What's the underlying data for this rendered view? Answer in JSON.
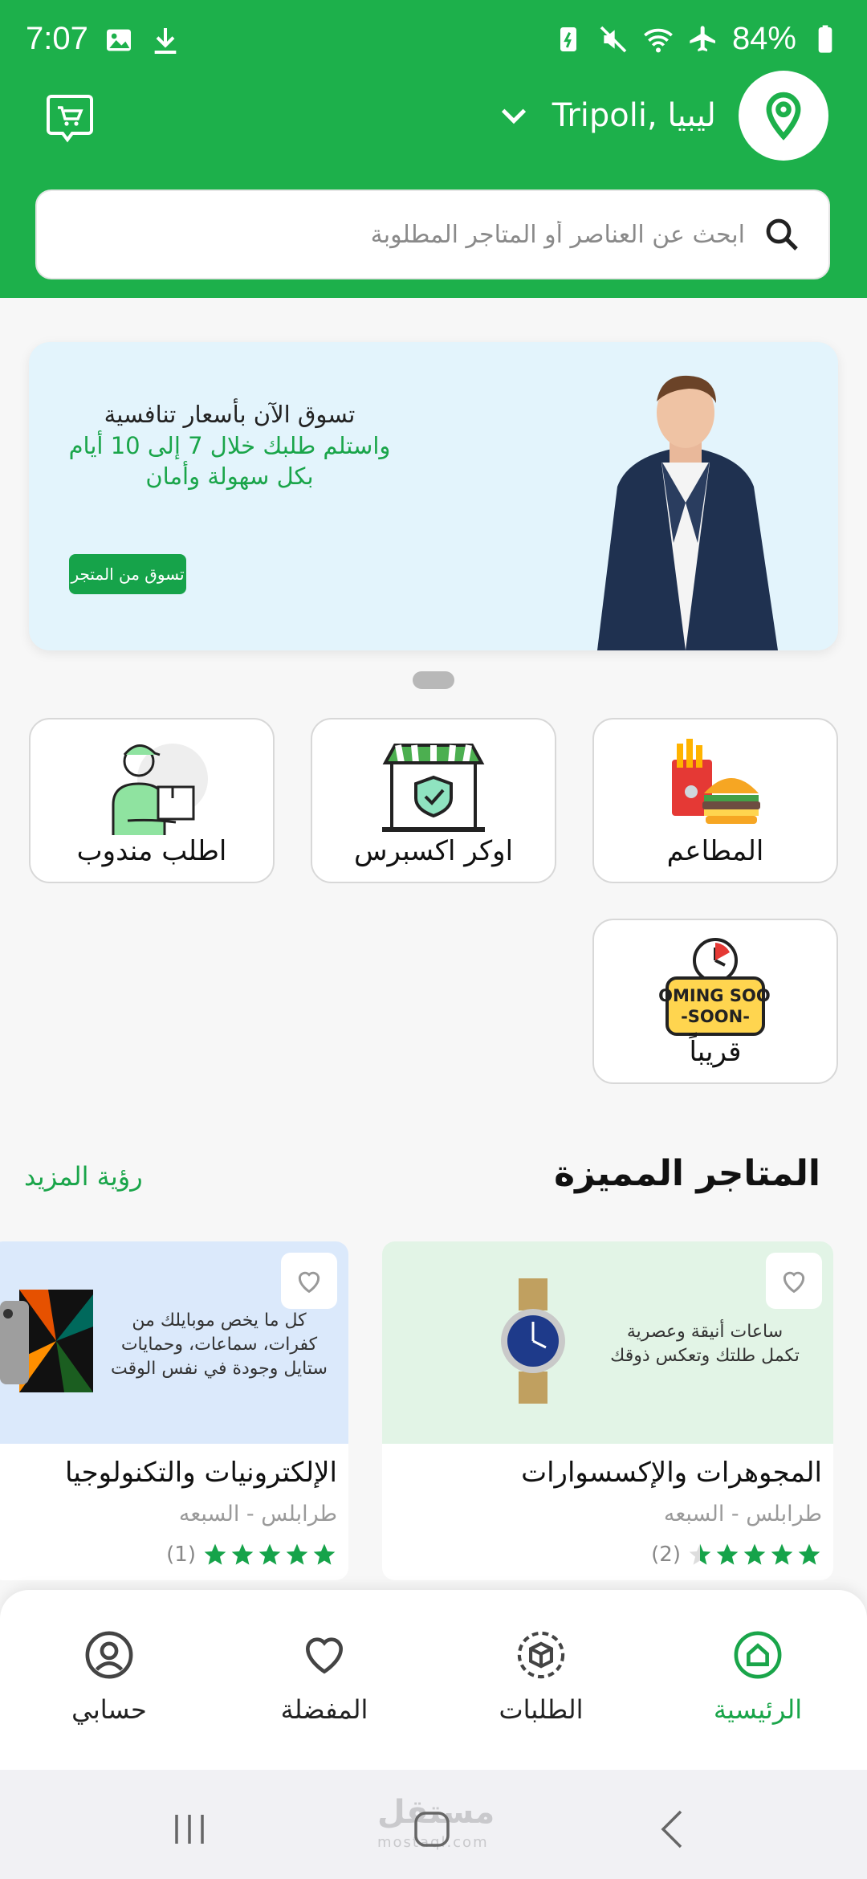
{
  "status_bar": {
    "time": "7:07",
    "battery": "84%"
  },
  "header": {
    "location": "Tripoli, ليبيا",
    "search_placeholder": "ابحث عن العناصر أو المتاجر المطلوبة"
  },
  "banner": {
    "line1": "تسوق الآن بأسعار تنافسية",
    "line2": "واستلم طلبك خلال 7 إلى 10 أيام",
    "line3": "بكل سهولة وأمان",
    "button": "تسوق من المتجر"
  },
  "categories": [
    {
      "label": "المطاعم"
    },
    {
      "label": "اوكر اكسبرس"
    },
    {
      "label": "اطلب مندوب"
    },
    {
      "label": "قريباً",
      "badge": "COMING SOON"
    }
  ],
  "featured": {
    "title": "المتاجر المميزة",
    "see_more": "رؤية المزيد",
    "stores": [
      {
        "name": "المجوهرات والإكسسوارات",
        "location": "طرابلس - السبعه",
        "rating": 4.5,
        "rating_count": "(2)",
        "promo1": "ساعات أنيقة وعصرية",
        "promo2": "تكمل طلتك وتعكس ذوقك"
      },
      {
        "name": "الإلكترونيات والتكنولوجيا",
        "location": "طرابلس - السبعه",
        "rating": 5,
        "rating_count": "(1)",
        "promo1": "كل ما يخص موبايلك من",
        "promo2": "كفرات، سماعات، وحمايات",
        "promo3": "ستايل وجودة في نفس الوقت"
      }
    ]
  },
  "bottom_nav": [
    {
      "label": "الرئيسية",
      "icon": "home-icon",
      "active": true
    },
    {
      "label": "الطلبات",
      "icon": "orders-icon"
    },
    {
      "label": "المفضلة",
      "icon": "heart-icon"
    },
    {
      "label": "حسابي",
      "icon": "profile-icon"
    }
  ],
  "watermark": {
    "text": "مستقل",
    "sub": "mostaql.com"
  },
  "colors": {
    "primary": "#1db04b",
    "accent_text": "#1aa54a",
    "star": "#16a34a"
  }
}
